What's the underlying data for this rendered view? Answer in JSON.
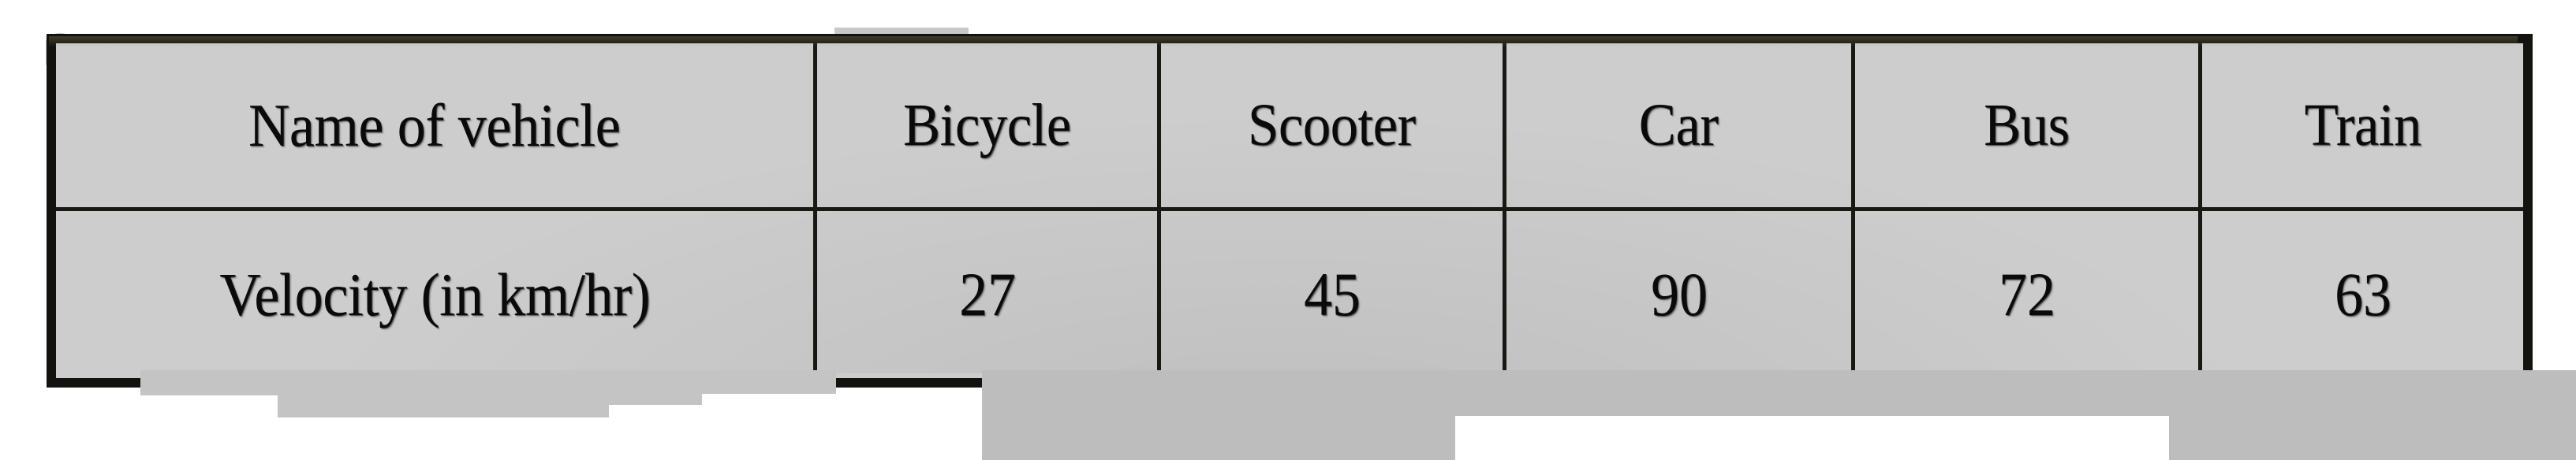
{
  "document": {
    "type": "scanned-textbook-table",
    "caption": ""
  },
  "table": {
    "row_labels": [
      "Name of vehicle",
      "Velocity (in km/hr)"
    ],
    "columns": [
      "Bicycle",
      "Scooter",
      "Car",
      "Bus",
      "Train"
    ],
    "values": [
      "27",
      "45",
      "90",
      "72",
      "63"
    ],
    "colors": {
      "label_cell_bg": "#b5b1a3",
      "data_cell_bg": "#cdcdcd",
      "border": "#14120e",
      "text": "#0a0a0a",
      "page_bg": "#ffffff",
      "artifact": "#c4c4c4"
    }
  },
  "chart_data": {
    "type": "table",
    "title": "",
    "categories": [
      "Bicycle",
      "Scooter",
      "Car",
      "Bus",
      "Train"
    ],
    "values": [
      27,
      45,
      90,
      72,
      63
    ],
    "xlabel": "Name of vehicle",
    "ylabel": "Velocity (in km/hr)",
    "series": [
      {
        "name": "Velocity (in km/hr)",
        "values": [
          27,
          45,
          90,
          72,
          63
        ]
      }
    ],
    "row_headers": [
      "Name of vehicle",
      "Velocity (in km/hr)"
    ],
    "units": "km/hr",
    "grid": true,
    "legend": "none"
  }
}
